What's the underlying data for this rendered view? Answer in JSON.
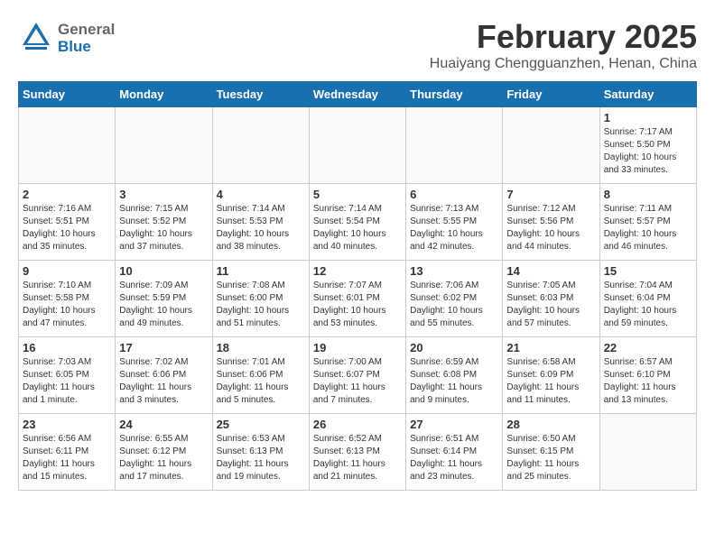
{
  "header": {
    "logo": {
      "general": "General",
      "blue": "Blue"
    },
    "title": "February 2025",
    "location": "Huaiyang Chengguanzhen, Henan, China"
  },
  "calendar": {
    "days_of_week": [
      "Sunday",
      "Monday",
      "Tuesday",
      "Wednesday",
      "Thursday",
      "Friday",
      "Saturday"
    ],
    "weeks": [
      [
        {
          "day": "",
          "info": ""
        },
        {
          "day": "",
          "info": ""
        },
        {
          "day": "",
          "info": ""
        },
        {
          "day": "",
          "info": ""
        },
        {
          "day": "",
          "info": ""
        },
        {
          "day": "",
          "info": ""
        },
        {
          "day": "1",
          "info": "Sunrise: 7:17 AM\nSunset: 5:50 PM\nDaylight: 10 hours and 33 minutes."
        }
      ],
      [
        {
          "day": "2",
          "info": "Sunrise: 7:16 AM\nSunset: 5:51 PM\nDaylight: 10 hours and 35 minutes."
        },
        {
          "day": "3",
          "info": "Sunrise: 7:15 AM\nSunset: 5:52 PM\nDaylight: 10 hours and 37 minutes."
        },
        {
          "day": "4",
          "info": "Sunrise: 7:14 AM\nSunset: 5:53 PM\nDaylight: 10 hours and 38 minutes."
        },
        {
          "day": "5",
          "info": "Sunrise: 7:14 AM\nSunset: 5:54 PM\nDaylight: 10 hours and 40 minutes."
        },
        {
          "day": "6",
          "info": "Sunrise: 7:13 AM\nSunset: 5:55 PM\nDaylight: 10 hours and 42 minutes."
        },
        {
          "day": "7",
          "info": "Sunrise: 7:12 AM\nSunset: 5:56 PM\nDaylight: 10 hours and 44 minutes."
        },
        {
          "day": "8",
          "info": "Sunrise: 7:11 AM\nSunset: 5:57 PM\nDaylight: 10 hours and 46 minutes."
        }
      ],
      [
        {
          "day": "9",
          "info": "Sunrise: 7:10 AM\nSunset: 5:58 PM\nDaylight: 10 hours and 47 minutes."
        },
        {
          "day": "10",
          "info": "Sunrise: 7:09 AM\nSunset: 5:59 PM\nDaylight: 10 hours and 49 minutes."
        },
        {
          "day": "11",
          "info": "Sunrise: 7:08 AM\nSunset: 6:00 PM\nDaylight: 10 hours and 51 minutes."
        },
        {
          "day": "12",
          "info": "Sunrise: 7:07 AM\nSunset: 6:01 PM\nDaylight: 10 hours and 53 minutes."
        },
        {
          "day": "13",
          "info": "Sunrise: 7:06 AM\nSunset: 6:02 PM\nDaylight: 10 hours and 55 minutes."
        },
        {
          "day": "14",
          "info": "Sunrise: 7:05 AM\nSunset: 6:03 PM\nDaylight: 10 hours and 57 minutes."
        },
        {
          "day": "15",
          "info": "Sunrise: 7:04 AM\nSunset: 6:04 PM\nDaylight: 10 hours and 59 minutes."
        }
      ],
      [
        {
          "day": "16",
          "info": "Sunrise: 7:03 AM\nSunset: 6:05 PM\nDaylight: 11 hours and 1 minute."
        },
        {
          "day": "17",
          "info": "Sunrise: 7:02 AM\nSunset: 6:06 PM\nDaylight: 11 hours and 3 minutes."
        },
        {
          "day": "18",
          "info": "Sunrise: 7:01 AM\nSunset: 6:06 PM\nDaylight: 11 hours and 5 minutes."
        },
        {
          "day": "19",
          "info": "Sunrise: 7:00 AM\nSunset: 6:07 PM\nDaylight: 11 hours and 7 minutes."
        },
        {
          "day": "20",
          "info": "Sunrise: 6:59 AM\nSunset: 6:08 PM\nDaylight: 11 hours and 9 minutes."
        },
        {
          "day": "21",
          "info": "Sunrise: 6:58 AM\nSunset: 6:09 PM\nDaylight: 11 hours and 11 minutes."
        },
        {
          "day": "22",
          "info": "Sunrise: 6:57 AM\nSunset: 6:10 PM\nDaylight: 11 hours and 13 minutes."
        }
      ],
      [
        {
          "day": "23",
          "info": "Sunrise: 6:56 AM\nSunset: 6:11 PM\nDaylight: 11 hours and 15 minutes."
        },
        {
          "day": "24",
          "info": "Sunrise: 6:55 AM\nSunset: 6:12 PM\nDaylight: 11 hours and 17 minutes."
        },
        {
          "day": "25",
          "info": "Sunrise: 6:53 AM\nSunset: 6:13 PM\nDaylight: 11 hours and 19 minutes."
        },
        {
          "day": "26",
          "info": "Sunrise: 6:52 AM\nSunset: 6:13 PM\nDaylight: 11 hours and 21 minutes."
        },
        {
          "day": "27",
          "info": "Sunrise: 6:51 AM\nSunset: 6:14 PM\nDaylight: 11 hours and 23 minutes."
        },
        {
          "day": "28",
          "info": "Sunrise: 6:50 AM\nSunset: 6:15 PM\nDaylight: 11 hours and 25 minutes."
        },
        {
          "day": "",
          "info": ""
        }
      ]
    ]
  }
}
